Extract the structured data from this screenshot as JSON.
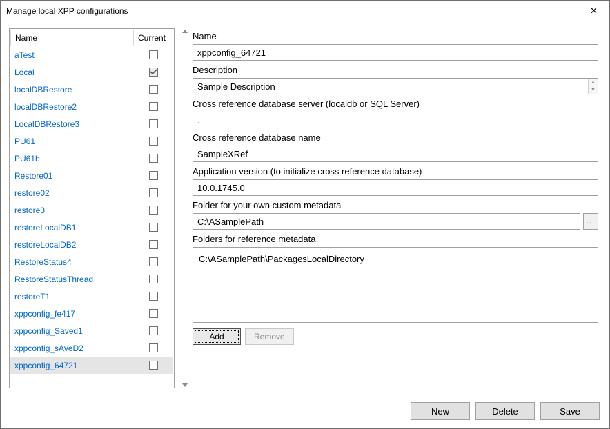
{
  "window": {
    "title": "Manage local XPP configurations",
    "close_glyph": "✕"
  },
  "list": {
    "header_name": "Name",
    "header_current": "Current",
    "rows": [
      {
        "name": "aTest",
        "current": false,
        "selected": false
      },
      {
        "name": "Local",
        "current": true,
        "selected": false
      },
      {
        "name": "localDBRestore",
        "current": false,
        "selected": false
      },
      {
        "name": "localDBRestore2",
        "current": false,
        "selected": false
      },
      {
        "name": "LocalDBRestore3",
        "current": false,
        "selected": false
      },
      {
        "name": "PU61",
        "current": false,
        "selected": false
      },
      {
        "name": "PU61b",
        "current": false,
        "selected": false
      },
      {
        "name": "Restore01",
        "current": false,
        "selected": false
      },
      {
        "name": "restore02",
        "current": false,
        "selected": false
      },
      {
        "name": "restore3",
        "current": false,
        "selected": false
      },
      {
        "name": "restoreLocalDB1",
        "current": false,
        "selected": false
      },
      {
        "name": "restoreLocalDB2",
        "current": false,
        "selected": false
      },
      {
        "name": "RestoreStatus4",
        "current": false,
        "selected": false
      },
      {
        "name": "RestoreStatusThread",
        "current": false,
        "selected": false
      },
      {
        "name": "restoreT1",
        "current": false,
        "selected": false
      },
      {
        "name": "xppconfig_fe417",
        "current": false,
        "selected": false
      },
      {
        "name": "xppconfig_Saved1",
        "current": false,
        "selected": false
      },
      {
        "name": "xppconfig_sAveD2",
        "current": false,
        "selected": false
      },
      {
        "name": "xppconfig_64721",
        "current": false,
        "selected": true
      }
    ]
  },
  "form": {
    "labels": {
      "name": "Name",
      "description": "Description",
      "xref_server": "Cross reference database server (localdb or SQL Server)",
      "xref_db": "Cross reference database name",
      "app_version": "Application version (to initialize cross reference database)",
      "custom_metadata": "Folder for your own custom metadata",
      "ref_metadata": "Folders for reference metadata"
    },
    "values": {
      "name": "xppconfig_64721",
      "description": "Sample Description",
      "xref_server": ".",
      "xref_db": "SampleXRef",
      "app_version": "10.0.1745.0",
      "custom_metadata": "C:\\ASamplePath"
    },
    "ref_list": [
      "C:\\ASamplePath\\PackagesLocalDirectory"
    ],
    "browse_glyph": "..."
  },
  "buttons": {
    "add": "Add",
    "remove": "Remove",
    "new": "New",
    "delete": "Delete",
    "save": "Save"
  }
}
